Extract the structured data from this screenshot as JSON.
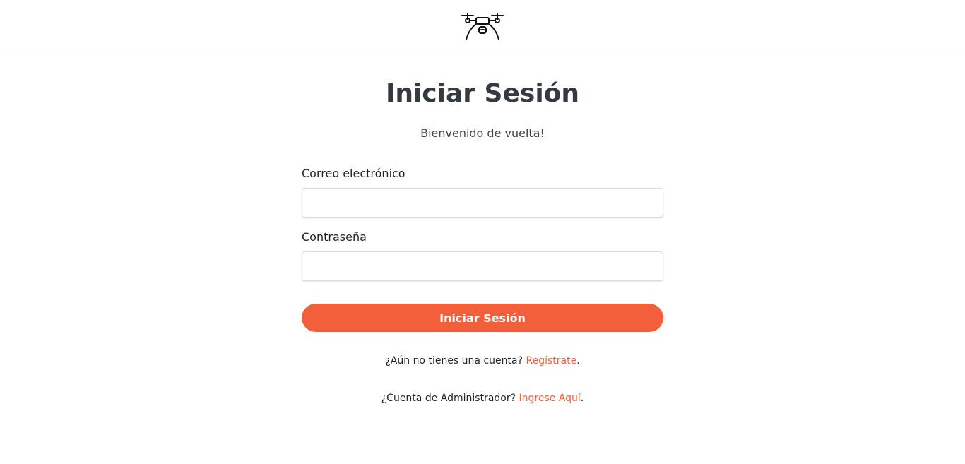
{
  "header": {
    "logo_icon": "drone-icon"
  },
  "login": {
    "title": "Iniciar Sesión",
    "subtitle": "Bienvenido de vuelta!",
    "email_label": "Correo electrónico",
    "email_value": "",
    "password_label": "Contraseña",
    "password_value": "",
    "submit_label": "Iniciar Sesión"
  },
  "links": {
    "register_prompt": "¿Aún no tienes una cuenta?",
    "register_link": "Regístrate",
    "register_suffix": ".",
    "admin_prompt": "¿Cuenta de Administrador?",
    "admin_link": "Ingrese Aquí",
    "admin_suffix": "."
  },
  "colors": {
    "accent": "#f45f3b",
    "heading": "#343a40"
  }
}
